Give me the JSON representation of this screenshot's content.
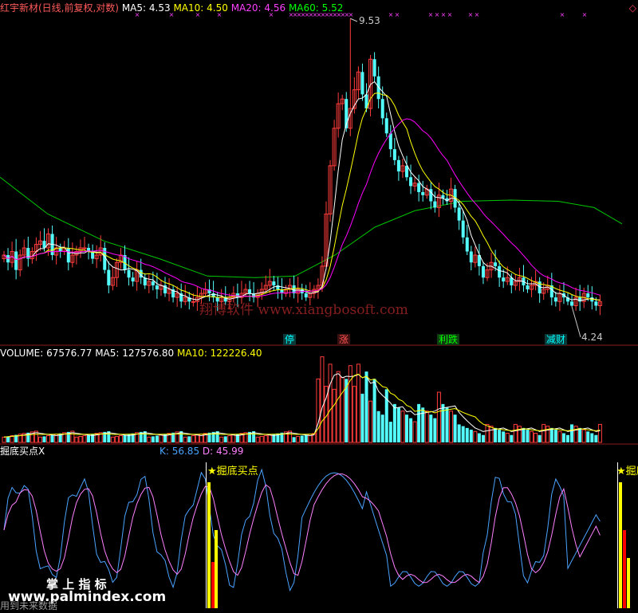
{
  "main": {
    "title": "红宇新材(日线,前复权,对数)",
    "indicators": [
      {
        "label": "MA5: 4.53",
        "color": "#ffffff"
      },
      {
        "label": "MA10: 4.50",
        "color": "#ffff00"
      },
      {
        "label": "MA20: 4.56",
        "color": "#ff00ff"
      },
      {
        "label": "MA60: 5.52",
        "color": "#00ff00"
      }
    ],
    "high_label": "9.53",
    "low_label": "4.24",
    "signals": [
      {
        "text": "停",
        "color": "#00ffff"
      },
      {
        "text": "涨",
        "color": "#ff5050"
      },
      {
        "text": "利跌",
        "color": "#00ff00"
      },
      {
        "text": "减财",
        "color": "#00ffff"
      }
    ],
    "corner_icon": "diamond-outline-icon"
  },
  "volume": {
    "indicators": [
      {
        "label": "VOLUME: 67576.77",
        "color": "#ffffff"
      },
      {
        "label": "MA5: 127576.80",
        "color": "#ffffff"
      },
      {
        "label": "MA10: 122226.40",
        "color": "#ffff00"
      }
    ]
  },
  "oscillator": {
    "title": "掘底买点X",
    "indicators": [
      {
        "label": "K: 56.85",
        "color": "#4aa3ff"
      },
      {
        "label": "D: 45.99",
        "color": "#ff80ff"
      }
    ],
    "signal_label": "掘底买点",
    "footer": "用到未来数据"
  },
  "watermarks": {
    "site": "翔博软件 www.xiangbosoft.com",
    "brand": "掌 上 指 标",
    "url": "www.palmindex.com"
  },
  "chart_data": [
    {
      "type": "candlestick",
      "title": "红宇新材(日线,前复权,对数)",
      "series": [
        {
          "name": "MA5",
          "values": [
            4.53
          ]
        },
        {
          "name": "MA10",
          "values": [
            4.5
          ]
        },
        {
          "name": "MA20",
          "values": [
            4.56
          ]
        },
        {
          "name": "MA60",
          "values": [
            5.52
          ]
        }
      ],
      "period_high": 9.53,
      "period_low": 4.24,
      "candle_closes": [
        4.9,
        4.8,
        4.95,
        4.7,
        4.9,
        5.0,
        4.85,
        4.95,
        5.05,
        5.1,
        5.0,
        5.2,
        4.9,
        5.0,
        4.95,
        5.0,
        4.8,
        4.9,
        4.95,
        5.0,
        5.0,
        4.95,
        4.85,
        4.9,
        5.0,
        4.7,
        4.5,
        4.6,
        4.8,
        4.9,
        4.7,
        4.6,
        4.55,
        4.7,
        4.6,
        4.5,
        4.55,
        4.5,
        4.45,
        4.5,
        4.4,
        4.45,
        4.35,
        4.4,
        4.3,
        4.35,
        4.3,
        4.3,
        4.35,
        4.4,
        4.45,
        4.4,
        4.35,
        4.3,
        4.35,
        4.3,
        4.35,
        4.4,
        4.35,
        4.4,
        4.45,
        4.4,
        4.35,
        4.4,
        4.45,
        4.5,
        4.55,
        4.5,
        4.45,
        4.4,
        4.45,
        4.5,
        4.4,
        4.45,
        4.4,
        4.35,
        4.4,
        4.45,
        4.5,
        4.75,
        5.5,
        6.3,
        7.0,
        7.5,
        7.6,
        7.0,
        7.4,
        7.8,
        8.2,
        7.7,
        7.4,
        8.5,
        8.1,
        7.6,
        7.2,
        6.9,
        6.6,
        6.4,
        6.2,
        6.3,
        6.1,
        5.95,
        6.0,
        5.85,
        5.8,
        5.9,
        5.7,
        5.6,
        5.8,
        5.75,
        5.7,
        5.9,
        5.6,
        5.4,
        5.15,
        4.95,
        4.8,
        4.9,
        4.75,
        4.6,
        4.7,
        4.8,
        4.75,
        4.6,
        4.55,
        4.6,
        4.5,
        4.55,
        4.6,
        4.5,
        4.45,
        4.5,
        4.55,
        4.4,
        4.45,
        4.5,
        4.35,
        4.3,
        4.4,
        4.35,
        4.3,
        4.25,
        4.35,
        4.3,
        4.4,
        4.35,
        4.3,
        4.25,
        4.3
      ]
    },
    {
      "type": "bar",
      "title": "VOLUME",
      "series": [
        {
          "name": "VOLUME",
          "values": [
            67576.77
          ]
        },
        {
          "name": "MA5",
          "values": [
            127576.8
          ]
        },
        {
          "name": "MA10",
          "values": [
            122226.4
          ]
        }
      ]
    },
    {
      "type": "line",
      "title": "掘底买点X",
      "series": [
        {
          "name": "K",
          "values": [
            56.85
          ]
        },
        {
          "name": "D",
          "values": [
            45.99
          ]
        }
      ],
      "buy_signals": [
        "掘底买点",
        "掘底买点"
      ]
    }
  ]
}
